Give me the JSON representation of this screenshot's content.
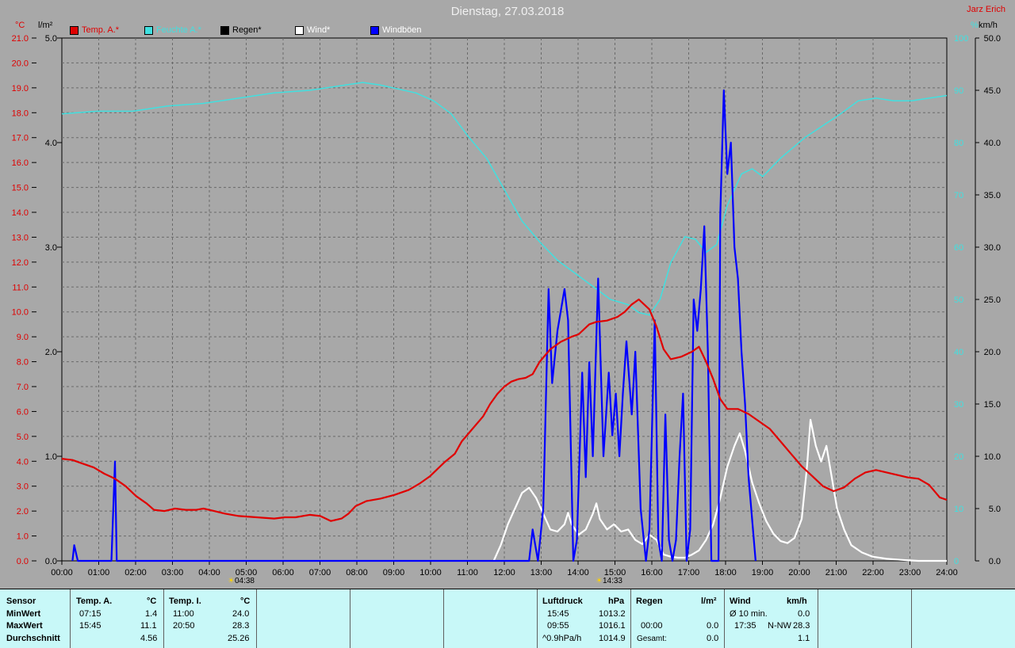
{
  "header": {
    "title": "Dienstag, 27.03.2018",
    "author": "Jarz Erich"
  },
  "units": {
    "left1": "°C",
    "left2": "l/m²",
    "right1": "%",
    "right2": "km/h"
  },
  "legend": [
    {
      "label": "Temp. A.*",
      "color": "#e00000"
    },
    {
      "label": "Feuchte A.*",
      "color": "#40e0e0"
    },
    {
      "label": "Regen*",
      "color": "#000000"
    },
    {
      "label": "Wind*",
      "color": "#ffffff"
    },
    {
      "label": "Windböen",
      "color": "#0000ff"
    }
  ],
  "markers": {
    "sunrise": "04:38",
    "sunset": "14:33"
  },
  "chart_data": {
    "type": "line",
    "x_ticks": [
      "00:00",
      "01:00",
      "02:00",
      "03:00",
      "04:00",
      "05:00",
      "06:00",
      "07:00",
      "08:00",
      "09:00",
      "10:00",
      "11:00",
      "12:00",
      "13:00",
      "14:00",
      "15:00",
      "16:00",
      "17:00",
      "18:00",
      "19:00",
      "20:00",
      "21:00",
      "22:00",
      "23:00",
      "24:00"
    ],
    "axes": {
      "temp_c": {
        "range": [
          0,
          21
        ],
        "ticks": [
          "0.0",
          "1.0",
          "2.0",
          "3.0",
          "4.0",
          "5.0",
          "6.0",
          "7.0",
          "8.0",
          "9.0",
          "10.0",
          "11.0",
          "12.0",
          "13.0",
          "14.0",
          "15.0",
          "16.0",
          "17.0",
          "18.0",
          "19.0",
          "20.0",
          "21.0"
        ]
      },
      "rain_lm2": {
        "range": [
          0,
          5
        ],
        "ticks": [
          "0.0",
          "1.0",
          "2.0",
          "3.0",
          "4.0",
          "5.0"
        ]
      },
      "humidity_pct": {
        "range": [
          0,
          100
        ],
        "ticks": [
          "0",
          "10",
          "20",
          "30",
          "40",
          "50",
          "60",
          "70",
          "80",
          "90",
          "100"
        ]
      },
      "wind_kmh": {
        "range": [
          0,
          50
        ],
        "ticks": [
          "0.0",
          "5.0",
          "10.0",
          "15.0",
          "20.0",
          "25.0",
          "30.0",
          "35.0",
          "40.0",
          "45.0",
          "50.0"
        ]
      }
    },
    "grid": true,
    "series": [
      {
        "name": "Temp. A.*",
        "axis": "temp_c",
        "color": "#e00000",
        "points": [
          [
            0,
            4.1
          ],
          [
            0.3,
            4.05
          ],
          [
            0.6,
            3.9
          ],
          [
            0.9,
            3.75
          ],
          [
            1.2,
            3.5
          ],
          [
            1.5,
            3.3
          ],
          [
            1.8,
            3.0
          ],
          [
            2.1,
            2.6
          ],
          [
            2.4,
            2.3
          ],
          [
            2.6,
            2.05
          ],
          [
            2.9,
            2.0
          ],
          [
            3.2,
            2.1
          ],
          [
            3.5,
            2.05
          ],
          [
            3.8,
            2.05
          ],
          [
            4.0,
            2.1
          ],
          [
            4.3,
            2.0
          ],
          [
            4.6,
            1.9
          ],
          [
            5.0,
            1.8
          ],
          [
            5.5,
            1.75
          ],
          [
            6.0,
            1.7
          ],
          [
            6.3,
            1.75
          ],
          [
            6.6,
            1.75
          ],
          [
            7.0,
            1.85
          ],
          [
            7.3,
            1.8
          ],
          [
            7.6,
            1.6
          ],
          [
            7.9,
            1.7
          ],
          [
            8.1,
            1.9
          ],
          [
            8.3,
            2.2
          ],
          [
            8.6,
            2.4
          ],
          [
            9.0,
            2.5
          ],
          [
            9.4,
            2.65
          ],
          [
            9.8,
            2.85
          ],
          [
            10.1,
            3.1
          ],
          [
            10.4,
            3.4
          ],
          [
            10.8,
            3.95
          ],
          [
            11.1,
            4.3
          ],
          [
            11.3,
            4.8
          ],
          [
            11.6,
            5.3
          ],
          [
            11.9,
            5.8
          ],
          [
            12.1,
            6.3
          ],
          [
            12.3,
            6.7
          ],
          [
            12.5,
            7.0
          ],
          [
            12.7,
            7.2
          ],
          [
            12.9,
            7.3
          ],
          [
            13.1,
            7.35
          ],
          [
            13.3,
            7.5
          ],
          [
            13.5,
            8.0
          ],
          [
            13.8,
            8.5
          ],
          [
            14.1,
            8.8
          ],
          [
            14.4,
            9.0
          ],
          [
            14.6,
            9.1
          ],
          [
            14.9,
            9.5
          ],
          [
            15.1,
            9.6
          ],
          [
            15.4,
            9.65
          ],
          [
            15.7,
            9.8
          ],
          [
            15.9,
            10.0
          ],
          [
            16.1,
            10.3
          ],
          [
            16.3,
            10.5
          ],
          [
            16.6,
            10.1
          ],
          [
            16.8,
            9.4
          ],
          [
            17.0,
            8.5
          ],
          [
            17.2,
            8.1
          ],
          [
            17.5,
            8.2
          ],
          [
            17.8,
            8.4
          ],
          [
            18.0,
            8.6
          ],
          [
            18.2,
            8.0
          ],
          [
            18.4,
            7.3
          ],
          [
            18.6,
            6.5
          ],
          [
            18.8,
            6.1
          ],
          [
            19.1,
            6.1
          ],
          [
            19.4,
            5.9
          ],
          [
            19.7,
            5.6
          ],
          [
            20.0,
            5.3
          ],
          [
            20.3,
            4.8
          ],
          [
            20.6,
            4.3
          ],
          [
            20.9,
            3.8
          ],
          [
            21.2,
            3.4
          ],
          [
            21.5,
            3.0
          ],
          [
            21.8,
            2.8
          ],
          [
            22.1,
            2.95
          ],
          [
            22.4,
            3.3
          ],
          [
            22.7,
            3.55
          ],
          [
            23.0,
            3.65
          ],
          [
            23.3,
            3.55
          ],
          [
            23.6,
            3.45
          ],
          [
            23.9,
            3.35
          ],
          [
            24.2,
            3.3
          ],
          [
            24.5,
            3.05
          ],
          [
            24.8,
            2.55
          ],
          [
            25.0,
            2.45
          ]
        ]
      },
      {
        "name": "Feuchte A.*",
        "axis": "humidity_pct",
        "color": "#40e0e0",
        "points": [
          [
            0,
            85.5
          ],
          [
            1.0,
            86.0
          ],
          [
            2.0,
            86.0
          ],
          [
            3.0,
            87.0
          ],
          [
            4.0,
            87.5
          ],
          [
            5.0,
            88.5
          ],
          [
            6.0,
            89.5
          ],
          [
            7.0,
            90.0
          ],
          [
            8.0,
            91.0
          ],
          [
            8.5,
            91.5
          ],
          [
            9.0,
            91.0
          ],
          [
            10.0,
            89.5
          ],
          [
            10.5,
            88.0
          ],
          [
            11.0,
            85.5
          ],
          [
            11.5,
            81.0
          ],
          [
            12.0,
            77.0
          ],
          [
            12.5,
            71.0
          ],
          [
            13.0,
            65.0
          ],
          [
            13.5,
            61.0
          ],
          [
            14.0,
            57.5
          ],
          [
            14.5,
            55.0
          ],
          [
            15.0,
            52.5
          ],
          [
            15.5,
            50.0
          ],
          [
            16.0,
            49.0
          ],
          [
            16.3,
            47.5
          ],
          [
            16.6,
            47.0
          ],
          [
            16.9,
            50.0
          ],
          [
            17.2,
            57.0
          ],
          [
            17.6,
            62.0
          ],
          [
            17.9,
            61.5
          ],
          [
            18.2,
            59.0
          ],
          [
            18.5,
            60.5
          ],
          [
            18.8,
            68.0
          ],
          [
            19.2,
            74.0
          ],
          [
            19.5,
            75.0
          ],
          [
            19.8,
            73.5
          ],
          [
            20.3,
            77.0
          ],
          [
            21.0,
            81.0
          ],
          [
            22.0,
            85.5
          ],
          [
            22.5,
            88.0
          ],
          [
            23.0,
            88.5
          ],
          [
            23.5,
            88.0
          ],
          [
            24.0,
            88.0
          ],
          [
            24.5,
            88.5
          ],
          [
            25.0,
            89.0
          ]
        ]
      },
      {
        "name": "Wind*",
        "axis": "wind_kmh",
        "color": "#ffffff",
        "points": [
          [
            12.2,
            0
          ],
          [
            12.4,
            1.5
          ],
          [
            12.6,
            3.5
          ],
          [
            12.8,
            5.0
          ],
          [
            13.0,
            6.5
          ],
          [
            13.2,
            7.0
          ],
          [
            13.4,
            6.0
          ],
          [
            13.6,
            4.5
          ],
          [
            13.8,
            3.0
          ],
          [
            14.0,
            2.8
          ],
          [
            14.2,
            3.5
          ],
          [
            14.3,
            4.6
          ],
          [
            14.4,
            3.5
          ],
          [
            14.6,
            2.5
          ],
          [
            14.8,
            3.0
          ],
          [
            15.0,
            4.5
          ],
          [
            15.1,
            5.5
          ],
          [
            15.2,
            4.0
          ],
          [
            15.4,
            3.0
          ],
          [
            15.6,
            3.5
          ],
          [
            15.8,
            2.8
          ],
          [
            16.0,
            3.0
          ],
          [
            16.2,
            2.0
          ],
          [
            16.4,
            1.6
          ],
          [
            16.6,
            2.5
          ],
          [
            16.8,
            2.0
          ],
          [
            17.0,
            0.6
          ],
          [
            17.2,
            0.4
          ],
          [
            17.4,
            0.3
          ],
          [
            17.6,
            0.3
          ],
          [
            17.8,
            0.6
          ],
          [
            18.0,
            1.0
          ],
          [
            18.2,
            2.0
          ],
          [
            18.4,
            3.5
          ],
          [
            18.6,
            6.0
          ],
          [
            18.8,
            9.0
          ],
          [
            19.0,
            11.0
          ],
          [
            19.15,
            12.2
          ],
          [
            19.3,
            10.5
          ],
          [
            19.5,
            7.5
          ],
          [
            19.7,
            5.5
          ],
          [
            19.9,
            3.8
          ],
          [
            20.1,
            2.6
          ],
          [
            20.3,
            1.9
          ],
          [
            20.5,
            1.7
          ],
          [
            20.7,
            2.2
          ],
          [
            20.9,
            4.0
          ],
          [
            21.05,
            9.0
          ],
          [
            21.15,
            13.5
          ],
          [
            21.3,
            11.0
          ],
          [
            21.45,
            9.5
          ],
          [
            21.6,
            11.0
          ],
          [
            21.75,
            8.0
          ],
          [
            21.9,
            5.0
          ],
          [
            22.1,
            3.0
          ],
          [
            22.3,
            1.5
          ],
          [
            22.6,
            0.8
          ],
          [
            22.9,
            0.4
          ],
          [
            23.3,
            0.2
          ],
          [
            23.7,
            0.1
          ],
          [
            24.2,
            0
          ],
          [
            25.0,
            0
          ]
        ]
      },
      {
        "name": "Windböen",
        "axis": "wind_kmh",
        "color": "#0000ff",
        "points": [
          [
            0.3,
            0
          ],
          [
            0.35,
            1.5
          ],
          [
            0.45,
            0
          ],
          [
            1.4,
            0
          ],
          [
            1.5,
            9.5
          ],
          [
            1.55,
            0
          ],
          [
            13.2,
            0
          ],
          [
            13.3,
            3
          ],
          [
            13.45,
            0
          ],
          [
            13.6,
            5
          ],
          [
            13.75,
            26
          ],
          [
            13.85,
            17
          ],
          [
            14.0,
            22
          ],
          [
            14.2,
            26
          ],
          [
            14.3,
            23
          ],
          [
            14.45,
            0
          ],
          [
            14.55,
            2
          ],
          [
            14.7,
            18
          ],
          [
            14.8,
            8
          ],
          [
            14.9,
            19
          ],
          [
            15.0,
            10
          ],
          [
            15.15,
            27
          ],
          [
            15.3,
            10
          ],
          [
            15.45,
            18
          ],
          [
            15.55,
            12
          ],
          [
            15.65,
            16
          ],
          [
            15.75,
            10
          ],
          [
            15.85,
            16
          ],
          [
            15.95,
            21
          ],
          [
            16.1,
            14
          ],
          [
            16.2,
            20
          ],
          [
            16.35,
            5
          ],
          [
            16.5,
            0
          ],
          [
            16.6,
            3
          ],
          [
            16.75,
            23
          ],
          [
            16.85,
            2
          ],
          [
            16.95,
            0
          ],
          [
            17.05,
            14
          ],
          [
            17.15,
            2
          ],
          [
            17.25,
            0
          ],
          [
            17.35,
            2
          ],
          [
            17.45,
            10
          ],
          [
            17.55,
            16
          ],
          [
            17.65,
            0
          ],
          [
            17.75,
            3
          ],
          [
            17.85,
            25
          ],
          [
            17.95,
            22
          ],
          [
            18.05,
            26
          ],
          [
            18.15,
            32
          ],
          [
            18.25,
            20
          ],
          [
            18.35,
            0
          ],
          [
            18.55,
            0
          ],
          [
            18.6,
            33
          ],
          [
            18.7,
            45
          ],
          [
            18.8,
            37
          ],
          [
            18.9,
            40
          ],
          [
            19.0,
            30
          ],
          [
            19.1,
            27
          ],
          [
            19.2,
            20
          ],
          [
            19.3,
            15
          ],
          [
            19.4,
            8
          ],
          [
            19.6,
            0
          ]
        ]
      }
    ]
  },
  "table": {
    "sensor_header": "Sensor",
    "rows": [
      "MinWert",
      "MaxWert",
      "Durchschnitt"
    ],
    "temp_a": {
      "header": "Temp. A.",
      "unit": "°C",
      "min_time": "07:15",
      "min": "1.4",
      "max_time": "15:45",
      "max": "11.1",
      "avg": "4.56"
    },
    "temp_i": {
      "header": "Temp. I.",
      "unit": "°C",
      "min_time": "11:00",
      "min": "24.0",
      "max_time": "20:50",
      "max": "28.3",
      "avg": "25.26"
    },
    "pressure": {
      "header": "Luftdruck",
      "unit": "hPa",
      "min_time": "15:45",
      "min": "1013.2",
      "max_time": "09:55",
      "max": "1016.1",
      "trend": "^0.9hPa/h",
      "avg": "1014.9"
    },
    "rain": {
      "header": "Regen",
      "unit": "l/m²",
      "max_time": "00:00",
      "max": "0.0",
      "total_label": "Gesamt:",
      "total": "0.0"
    },
    "wind": {
      "header": "Wind",
      "unit": "km/h",
      "avg10_label": "Ø 10 min.",
      "avg10": "0.0",
      "max_time": "17:35",
      "max_dir": "N-NW",
      "max": "28.3",
      "avg": "1.1"
    }
  }
}
